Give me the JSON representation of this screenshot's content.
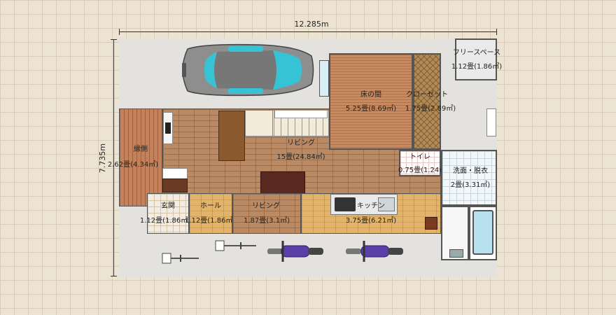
{
  "dimensions": {
    "width_label": "12.285m",
    "height_label": "7.735m"
  },
  "rooms": {
    "engawa": {
      "name": "縁側",
      "area": "2.62畳(4.34㎡)"
    },
    "tokonoma": {
      "name": "床の間",
      "area": "5.25畳(8.69㎡)"
    },
    "closet": {
      "name": "クローゼット",
      "area": "1.75畳(2.89㎡)"
    },
    "free_space": {
      "name": "フリースペース",
      "area": "1.12畳(1.86㎡)"
    },
    "living_main": {
      "name": "リビング",
      "area": "15畳(24.84㎡)"
    },
    "toilet": {
      "name": "トイレ",
      "area": "0.75畳(1.24㎡)"
    },
    "washroom": {
      "name": "洗面・脱衣",
      "area": "2畳(3.31㎡)"
    },
    "genkan": {
      "name": "玄関",
      "area": "1.12畳(1.86㎡)"
    },
    "hall": {
      "name": "ホール",
      "area": "1.12畳(1.86㎡)"
    },
    "living_small": {
      "name": "リビング",
      "area": "1.87畳(3.1㎡)"
    },
    "kitchen": {
      "name": "キッチン",
      "area": "3.75畳(6.21㎡)"
    }
  },
  "colors": {
    "car_body": "#8e8e8e",
    "car_glass": "#36c3d6",
    "motorcycle": "#5b3fa8",
    "plan_background": "#e4e2df"
  }
}
